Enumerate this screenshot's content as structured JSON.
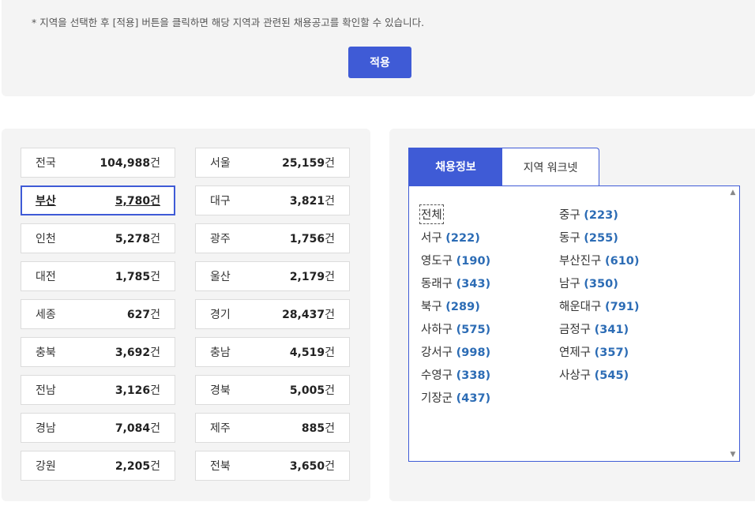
{
  "notice": "* 지역을 선택한 후 [적용] 버튼을 클릭하면 해당 지역과 관련된 채용공고를 확인할 수 있습니다.",
  "apply_label": "적용",
  "regions": [
    {
      "name": "전국",
      "count": "104,988",
      "unit": "건"
    },
    {
      "name": "서울",
      "count": "25,159",
      "unit": "건"
    },
    {
      "name": "부산",
      "count": "5,780",
      "unit": "건",
      "selected": true
    },
    {
      "name": "대구",
      "count": "3,821",
      "unit": "건"
    },
    {
      "name": "인천",
      "count": "5,278",
      "unit": "건"
    },
    {
      "name": "광주",
      "count": "1,756",
      "unit": "건"
    },
    {
      "name": "대전",
      "count": "1,785",
      "unit": "건"
    },
    {
      "name": "울산",
      "count": "2,179",
      "unit": "건"
    },
    {
      "name": "세종",
      "count": "627",
      "unit": "건"
    },
    {
      "name": "경기",
      "count": "28,437",
      "unit": "건"
    },
    {
      "name": "충북",
      "count": "3,692",
      "unit": "건"
    },
    {
      "name": "충남",
      "count": "4,519",
      "unit": "건"
    },
    {
      "name": "전남",
      "count": "3,126",
      "unit": "건"
    },
    {
      "name": "경북",
      "count": "5,005",
      "unit": "건"
    },
    {
      "name": "경남",
      "count": "7,084",
      "unit": "건"
    },
    {
      "name": "제주",
      "count": "885",
      "unit": "건"
    },
    {
      "name": "강원",
      "count": "2,205",
      "unit": "건"
    },
    {
      "name": "전북",
      "count": "3,650",
      "unit": "건"
    }
  ],
  "tabs": [
    {
      "label": "채용정보",
      "active": true
    },
    {
      "label": "지역 워크넷",
      "active": false
    }
  ],
  "districts": [
    {
      "name": "전체",
      "count": ""
    },
    {
      "name": "중구",
      "count": "(223)"
    },
    {
      "name": "서구",
      "count": "(222)"
    },
    {
      "name": "동구",
      "count": "(255)"
    },
    {
      "name": "영도구",
      "count": "(190)"
    },
    {
      "name": "부산진구",
      "count": "(610)"
    },
    {
      "name": "동래구",
      "count": "(343)"
    },
    {
      "name": "남구",
      "count": "(350)"
    },
    {
      "name": "북구",
      "count": "(289)"
    },
    {
      "name": "해운대구",
      "count": "(791)"
    },
    {
      "name": "사하구",
      "count": "(575)"
    },
    {
      "name": "금정구",
      "count": "(341)"
    },
    {
      "name": "강서구",
      "count": "(998)"
    },
    {
      "name": "연제구",
      "count": "(357)"
    },
    {
      "name": "수영구",
      "count": "(338)"
    },
    {
      "name": "사상구",
      "count": "(545)"
    },
    {
      "name": "기장군",
      "count": "(437)"
    }
  ],
  "icons": {
    "scroll_up": "triangle-up",
    "scroll_down": "triangle-down"
  },
  "colors": {
    "accent": "#3f5bd6",
    "count_link": "#2c6cb5"
  }
}
